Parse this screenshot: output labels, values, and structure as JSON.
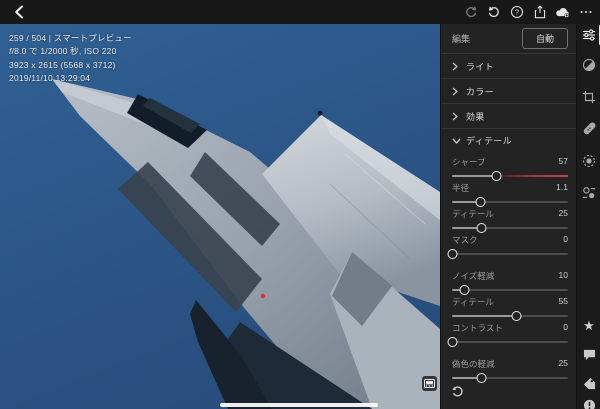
{
  "top_bar": {
    "icons": [
      "back",
      "redo",
      "undo",
      "help",
      "share",
      "cloud-sync",
      "more"
    ]
  },
  "photo_info": {
    "line1": "259 / 504 | スマートプレビュー",
    "line2_fstop": "f",
    "line2_rest": "/8.0 で 1/2000 秒, ISO 220",
    "line3": "3923 x 2615 (5568 x 3712)",
    "line4": "2019/11/10 13:29:04"
  },
  "edit_panel": {
    "title": "編集",
    "auto_button": "自動",
    "sections": [
      {
        "label": "ライト",
        "expanded": false
      },
      {
        "label": "カラー",
        "expanded": false
      },
      {
        "label": "効果",
        "expanded": false
      },
      {
        "label": "ディテール",
        "expanded": true
      }
    ],
    "detail_sliders": [
      {
        "label": "シャープ",
        "value": "57",
        "percent": 38,
        "accent": "red"
      },
      {
        "label": "半径",
        "value": "1.1",
        "percent": 24
      },
      {
        "label": "ディテール",
        "value": "25",
        "percent": 25
      },
      {
        "label": "マスク",
        "value": "0",
        "percent": 0
      },
      {
        "label": "ノイズ軽減",
        "value": "10",
        "percent": 10
      },
      {
        "label": "ディテール",
        "value": "55",
        "percent": 55
      },
      {
        "label": "コントラスト",
        "value": "0",
        "percent": 0
      },
      {
        "label": "偽色の軽減",
        "value": "25",
        "percent": 25
      }
    ],
    "reset_icon": "reset"
  },
  "rail_icons": [
    "edit-sliders",
    "tone-curve",
    "crop",
    "healing",
    "masking",
    "presets",
    "star-rating",
    "comment",
    "keyword-tag",
    "info"
  ],
  "photo_overlay_icons": [
    "filmstrip-toggle"
  ],
  "colors": {
    "accent_red": "#c64646",
    "top_bar_bg": "#181818",
    "panel_bg": "#232323",
    "rail_bg": "#1b1b1b",
    "sky_top": "#2f5f93",
    "sky_bottom": "#29507f",
    "jet_bright": "#ccd1d8",
    "jet_mid": "#8d97a3",
    "jet_shadow": "#39434f",
    "focus_dot": "#e03030"
  }
}
